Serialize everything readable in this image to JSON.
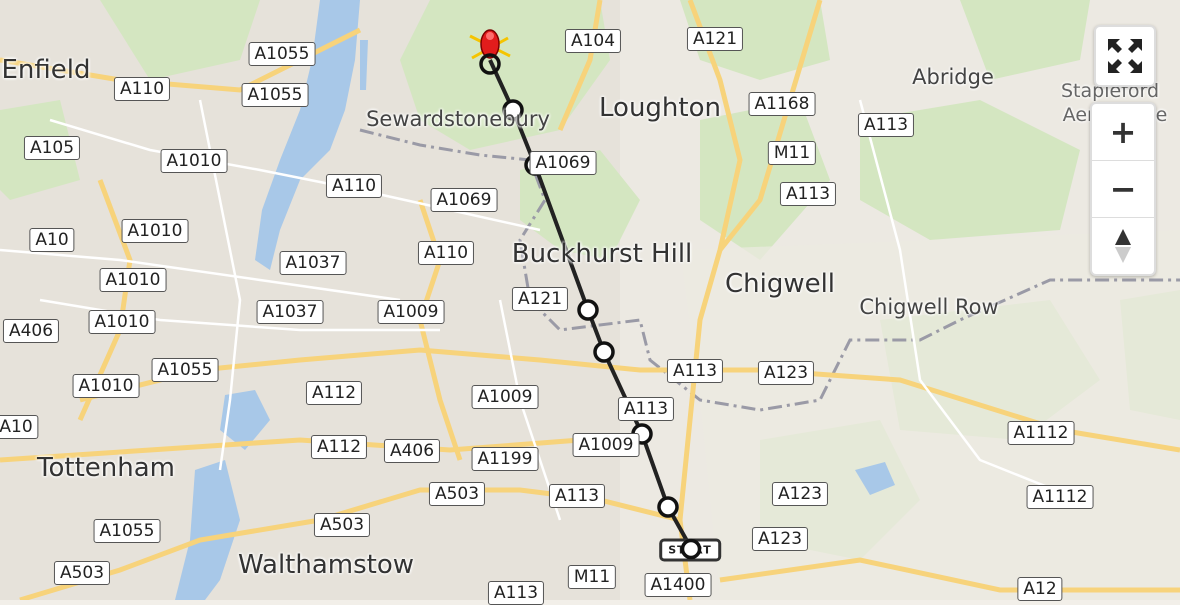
{
  "places": [
    {
      "id": "enfield",
      "label": "Enfield",
      "size": "large"
    },
    {
      "id": "loughton",
      "label": "Loughton",
      "size": "large"
    },
    {
      "id": "abridge",
      "label": "Abridge",
      "size": "small"
    },
    {
      "id": "stapleford",
      "label": "Stapleford",
      "size": "faint"
    },
    {
      "id": "aerodrome",
      "label": "Aerodrome",
      "size": "faint"
    },
    {
      "id": "sewardstonebury",
      "label": "Sewardstonebury",
      "size": "small"
    },
    {
      "id": "buckhurst_hill",
      "label": "Buckhurst Hill",
      "size": "large"
    },
    {
      "id": "chigwell",
      "label": "Chigwell",
      "size": "large"
    },
    {
      "id": "chigwell_row",
      "label": "Chigwell Row",
      "size": "small"
    },
    {
      "id": "tottenham",
      "label": "Tottenham",
      "size": "large"
    },
    {
      "id": "walthamstow",
      "label": "Walthamstow",
      "size": "large"
    }
  ],
  "roads": [
    "A1055",
    "A104",
    "A121",
    "A110",
    "A1055",
    "A1168",
    "A113",
    "A105",
    "A1010",
    "A1069",
    "M11",
    "A110",
    "A1069",
    "A113",
    "A10",
    "A1010",
    "A1037",
    "A110",
    "A121",
    "A1010",
    "A1037",
    "A1009",
    "A406",
    "A1010",
    "A1055",
    "A113",
    "A123",
    "A1010",
    "A112",
    "A1009",
    "A113",
    "A10",
    "A112",
    "A406",
    "A1199",
    "A1009",
    "A1112",
    "A503",
    "A113",
    "A123",
    "A1112",
    "A1055",
    "A503",
    "A123",
    "A503",
    "M11",
    "A1400",
    "A113",
    "A12"
  ],
  "route": {
    "start_label": "START",
    "end_marker": "helicopter-icon"
  },
  "controls": {
    "fullscreen": "fullscreen-icon",
    "zoom_in": "+",
    "zoom_out": "−",
    "compass": "compass-icon"
  },
  "colors": {
    "water": "#a8c8e8",
    "forest": "#d7e9c7",
    "urban": "#e8e4dc",
    "route": "#222222",
    "marker": "#e21c1c",
    "boundary": "#9a9aa6",
    "major_road": "#f7d37b"
  }
}
